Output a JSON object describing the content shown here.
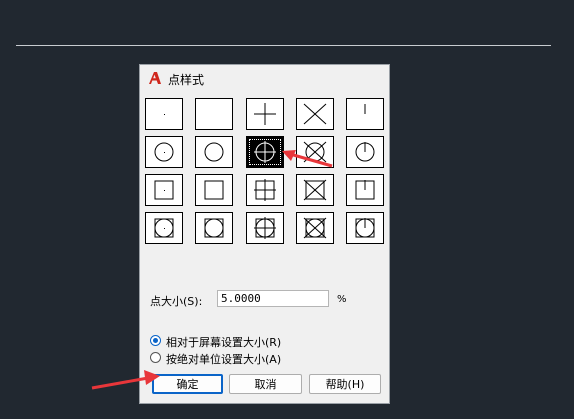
{
  "dialog": {
    "title": "点样式",
    "size_label": "点大小(S):",
    "size_value": "5.0000",
    "percent": "%",
    "radio_relative": "相对于屏幕设置大小(R)",
    "radio_absolute": "按绝对单位设置大小(A)",
    "selected_radio": "relative",
    "ok_label": "确定",
    "cancel_label": "取消",
    "help_label": "帮助(H)"
  },
  "styles": [
    "dot",
    "none",
    "plus",
    "x",
    "tick",
    "circle-dot",
    "circle",
    "circle-plus",
    "circle-x",
    "circle-tick",
    "square-dot",
    "square",
    "square-plus",
    "square-x",
    "square-tick",
    "square-circle-dot",
    "square-circle",
    "square-circle-plus",
    "square-circle-x",
    "square-circle-tick"
  ],
  "selected_style": "circle-plus",
  "colors": {
    "accent": "#0a64c8",
    "arrow": "#e8363a",
    "background": "#212830"
  }
}
